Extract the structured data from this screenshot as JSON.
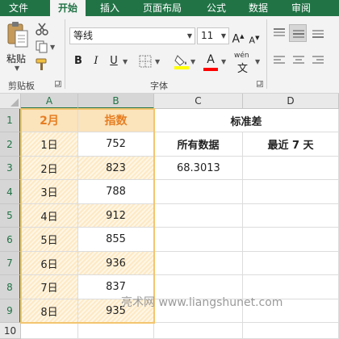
{
  "ribbon": {
    "tabs": [
      {
        "label": "文件",
        "active": false
      },
      {
        "label": "开始",
        "active": true
      },
      {
        "label": "插入",
        "active": false
      },
      {
        "label": "页面布局",
        "active": false
      },
      {
        "label": "公式",
        "active": false
      },
      {
        "label": "数据",
        "active": false
      },
      {
        "label": "审阅",
        "active": false
      }
    ],
    "clipboard": {
      "paste_label": "粘贴",
      "group_label": "剪贴板"
    },
    "font": {
      "group_label": "字体",
      "font_name": "等线",
      "font_size": "11",
      "bold": "B",
      "italic": "I",
      "underline": "U",
      "increase_font_label": "A",
      "decrease_font_label": "A",
      "font_color_label": "A",
      "phonetic_label": "wén"
    },
    "colors": {
      "accent": "#217346",
      "highlight": "#ffff00",
      "font_color": "#ff0000"
    }
  },
  "sheet": {
    "columns": [
      "A",
      "B",
      "C",
      "D"
    ],
    "rows": [
      "1",
      "2",
      "3",
      "4",
      "5",
      "6",
      "7",
      "8",
      "9",
      "10"
    ],
    "header_A": "2月",
    "header_B": "指数",
    "header_CD": "标准差",
    "sub_C": "所有数据",
    "sub_D": "最近 7 天",
    "result_C3": "68.3013",
    "data": [
      {
        "day": "1日",
        "value": "752"
      },
      {
        "day": "2日",
        "value": "823"
      },
      {
        "day": "3日",
        "value": "788"
      },
      {
        "day": "4日",
        "value": "912"
      },
      {
        "day": "5日",
        "value": "855"
      },
      {
        "day": "6日",
        "value": "936"
      },
      {
        "day": "7日",
        "value": "837"
      },
      {
        "day": "8日",
        "value": "935"
      }
    ]
  },
  "watermark": "亮术网 www.liangshunet.com"
}
